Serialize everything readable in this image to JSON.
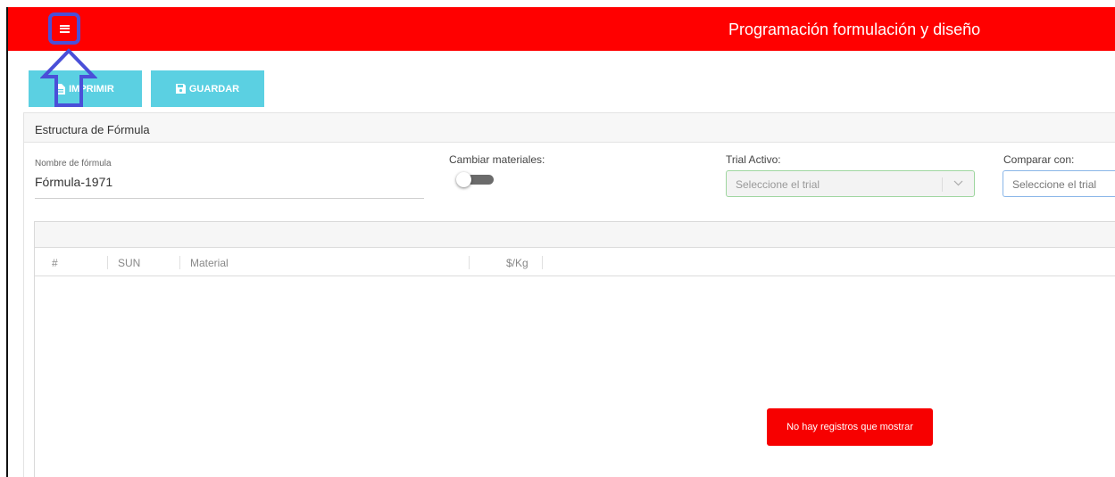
{
  "header": {
    "app_title": "Programación formulación y diseño",
    "menu_icon": "hamburger-menu-icon",
    "bar_color": "#ff0000"
  },
  "toolbar": {
    "print_label": "IMPRIMIR",
    "save_label": "GUARDAR",
    "print_icon": "file-icon",
    "save_icon": "floppy-disk-icon",
    "button_color": "#5bd0e2"
  },
  "annotation": {
    "icon": "up-arrow-icon",
    "color": "#4a4fd8"
  },
  "panel": {
    "title": "Estructura de Fórmula"
  },
  "form": {
    "name_label": "Nombre de fórmula",
    "name_value": "Fórmula-1971",
    "switch_label": "Cambiar materiales:",
    "switch_on": false,
    "trial_label": "Trial Activo:",
    "trial_placeholder": "Seleccione el trial",
    "compare_label": "Comparar con:",
    "compare_placeholder": "Seleccione el trial"
  },
  "table": {
    "columns": [
      "#",
      "SUN",
      "Material",
      "$/Kg"
    ],
    "rows": [],
    "empty_message": "No hay registros que mostrar",
    "empty_color": "#f70000"
  }
}
